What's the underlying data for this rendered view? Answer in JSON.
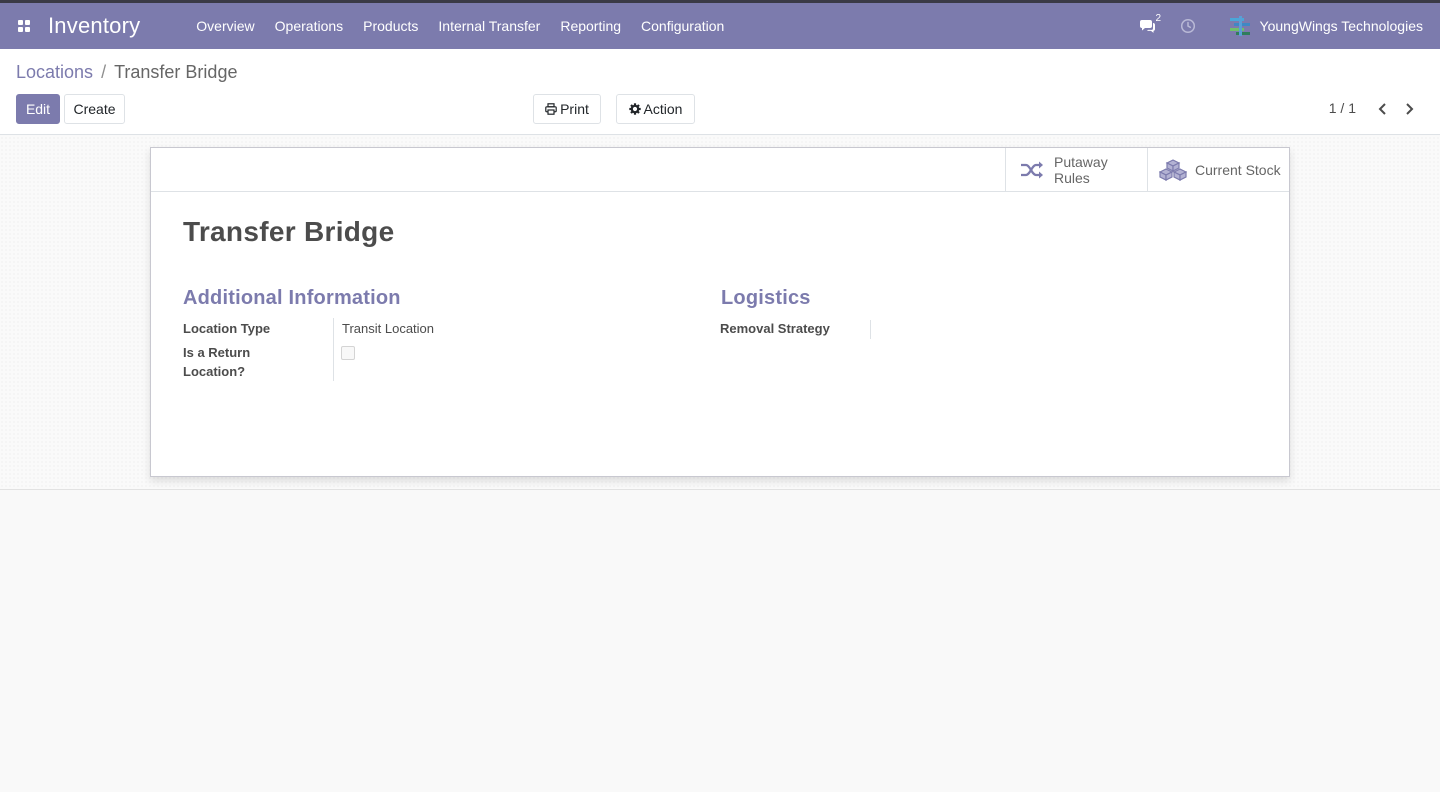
{
  "app": {
    "title": "Inventory",
    "menu": [
      "Overview",
      "Operations",
      "Products",
      "Internal Transfer",
      "Reporting",
      "Configuration"
    ],
    "chat_count": "2",
    "company": "YoungWings Technologies",
    "brand_color": "#7c7bad"
  },
  "breadcrumb": {
    "parent": "Locations",
    "separator": "/",
    "current": "Transfer Bridge"
  },
  "toolbar": {
    "edit_label": "Edit",
    "create_label": "Create",
    "print_label": "Print",
    "action_label": "Action"
  },
  "pager": {
    "value": "1 / 1"
  },
  "smart_buttons": {
    "putaway_line1": "Putaway",
    "putaway_line2": "Rules",
    "current_stock": "Current Stock"
  },
  "record": {
    "title": "Transfer Bridge",
    "group_left_title": "Additional Information",
    "group_right_title": "Logistics",
    "location_type_label": "Location Type",
    "location_type_value": "Transit Location",
    "return_location_label_1": "Is a Return",
    "return_location_label_2": "Location?",
    "return_location_checked": false,
    "removal_strategy_label": "Removal Strategy",
    "removal_strategy_value": ""
  }
}
